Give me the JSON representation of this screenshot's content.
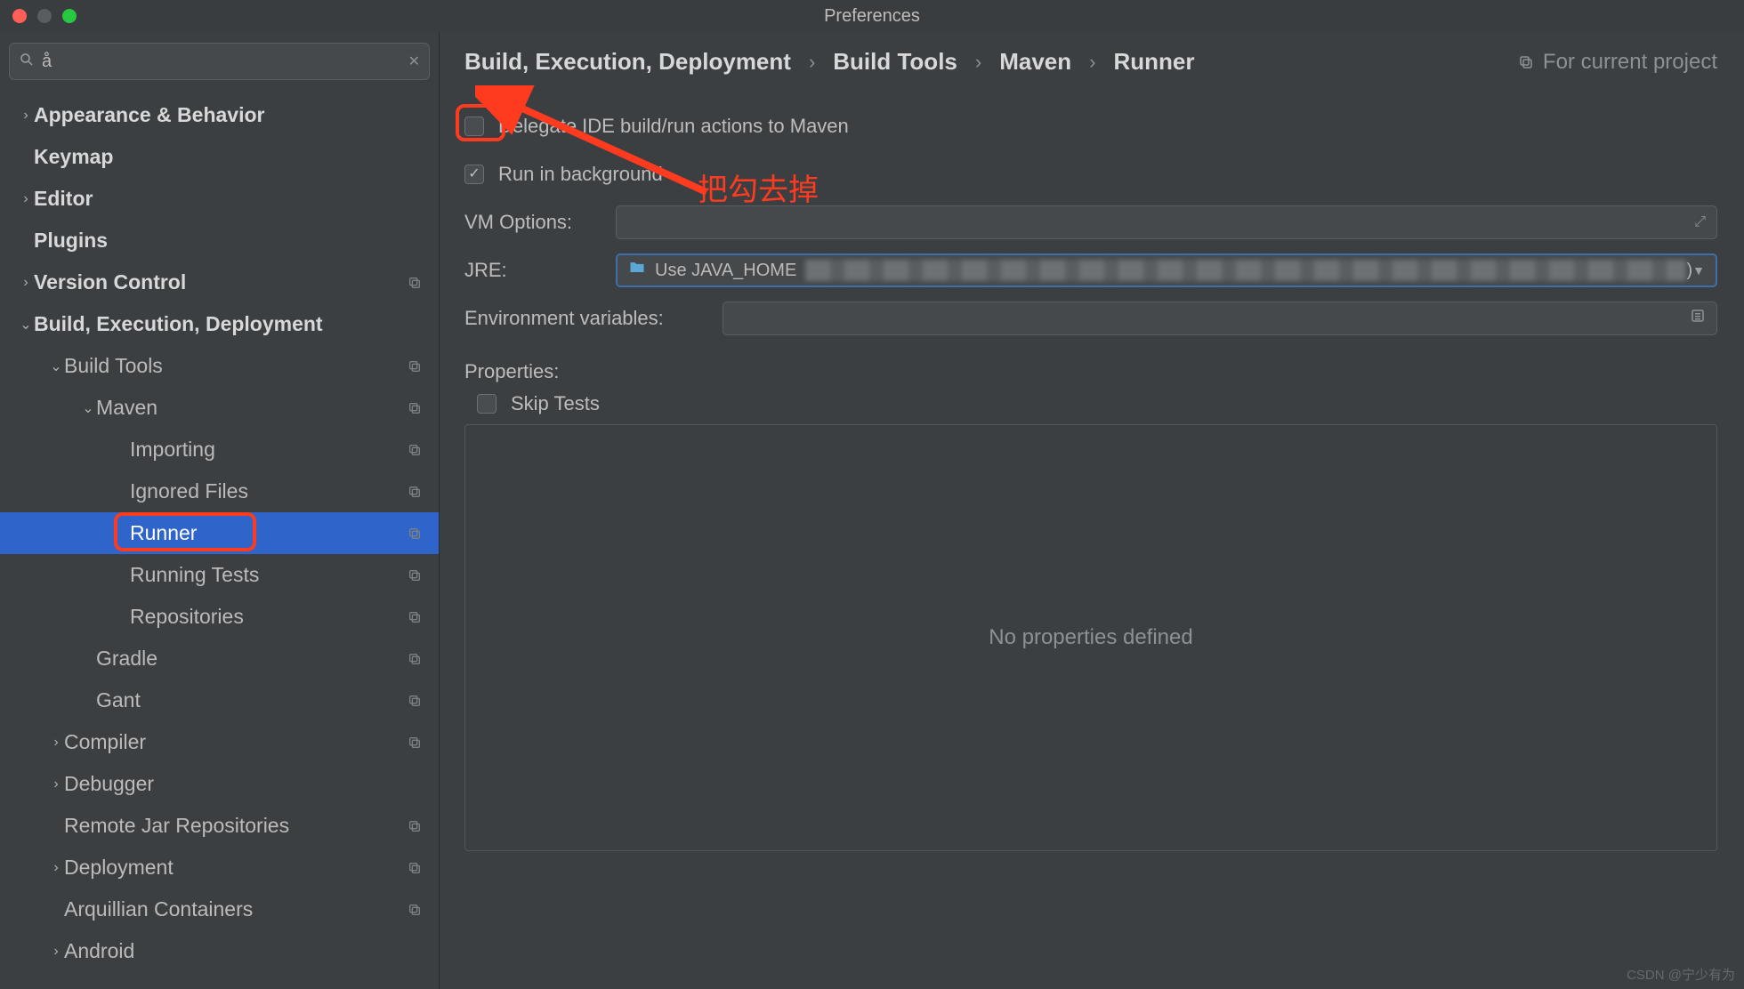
{
  "window": {
    "title": "Preferences"
  },
  "search": {
    "value": "å"
  },
  "sidebar": {
    "items": [
      {
        "label": "Appearance & Behavior",
        "indent": 0,
        "chev": "right",
        "bold": true,
        "copy": false
      },
      {
        "label": "Keymap",
        "indent": 0,
        "chev": "none",
        "bold": true,
        "copy": false
      },
      {
        "label": "Editor",
        "indent": 0,
        "chev": "right",
        "bold": true,
        "copy": false
      },
      {
        "label": "Plugins",
        "indent": 0,
        "chev": "none",
        "bold": true,
        "copy": false
      },
      {
        "label": "Version Control",
        "indent": 0,
        "chev": "right",
        "bold": true,
        "copy": true
      },
      {
        "label": "Build, Execution, Deployment",
        "indent": 0,
        "chev": "down",
        "bold": true,
        "copy": false
      },
      {
        "label": "Build Tools",
        "indent": 1,
        "chev": "down",
        "bold": false,
        "copy": true
      },
      {
        "label": "Maven",
        "indent": 2,
        "chev": "down",
        "bold": false,
        "copy": true
      },
      {
        "label": "Importing",
        "indent": 3,
        "chev": "none",
        "bold": false,
        "copy": true
      },
      {
        "label": "Ignored Files",
        "indent": 3,
        "chev": "none",
        "bold": false,
        "copy": true
      },
      {
        "label": "Runner",
        "indent": 3,
        "chev": "none",
        "bold": false,
        "copy": true,
        "selected": true,
        "anno": true
      },
      {
        "label": "Running Tests",
        "indent": 3,
        "chev": "none",
        "bold": false,
        "copy": true
      },
      {
        "label": "Repositories",
        "indent": 3,
        "chev": "none",
        "bold": false,
        "copy": true
      },
      {
        "label": "Gradle",
        "indent": 2,
        "chev": "none",
        "bold": false,
        "copy": true
      },
      {
        "label": "Gant",
        "indent": 2,
        "chev": "none",
        "bold": false,
        "copy": true
      },
      {
        "label": "Compiler",
        "indent": 1,
        "chev": "right",
        "bold": false,
        "copy": true
      },
      {
        "label": "Debugger",
        "indent": 1,
        "chev": "right",
        "bold": false,
        "copy": false
      },
      {
        "label": "Remote Jar Repositories",
        "indent": 1,
        "chev": "none",
        "bold": false,
        "copy": true
      },
      {
        "label": "Deployment",
        "indent": 1,
        "chev": "right",
        "bold": false,
        "copy": true
      },
      {
        "label": "Arquillian Containers",
        "indent": 1,
        "chev": "none",
        "bold": false,
        "copy": true
      },
      {
        "label": "Android",
        "indent": 1,
        "chev": "right",
        "bold": false,
        "copy": false
      }
    ]
  },
  "breadcrumbs": [
    "Build, Execution, Deployment",
    "Build Tools",
    "Maven",
    "Runner"
  ],
  "for_project_label": "For current project",
  "form": {
    "delegate_label": "Delegate IDE build/run actions to Maven",
    "run_bg_label": "Run in background",
    "vm_label": "VM Options:",
    "jre_label": "JRE:",
    "jre_value": "Use JAVA_HOME",
    "jre_suffix": ")",
    "env_label": "Environment variables:",
    "props_label": "Properties:",
    "skip_tests_label": "Skip Tests",
    "no_props": "No properties defined"
  },
  "annotation": {
    "text": "把勾去掉"
  },
  "watermark": "CSDN @宁少有为"
}
